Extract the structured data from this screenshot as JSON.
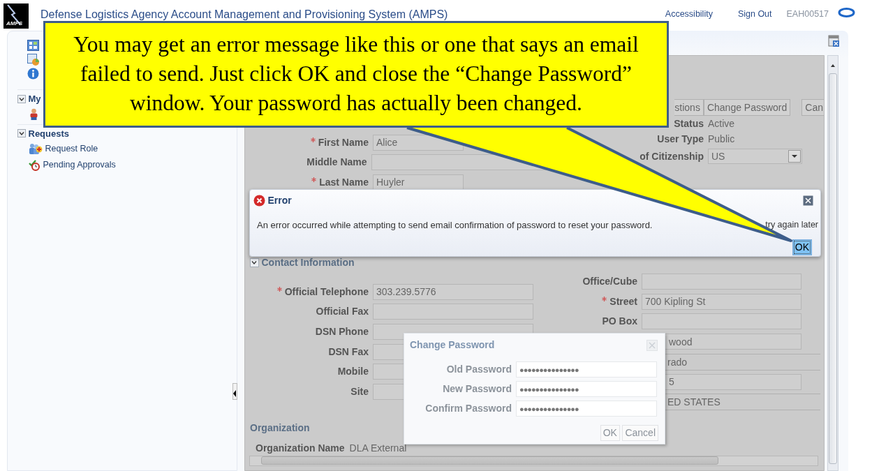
{
  "header": {
    "logo_text": "AMPS",
    "title": "Defense Logistics Agency Account Management and Provisioning System (AMPS)",
    "links": [
      "Accessibility",
      "Sign Out"
    ],
    "user": "EAH00517"
  },
  "sidebar": {
    "sections": [
      {
        "title": "My",
        "expanded": true,
        "items": [
          {
            "kind": "icon"
          }
        ]
      },
      {
        "title": "Requests",
        "expanded": true,
        "items": [
          {
            "kind": "link",
            "label": "Request Role"
          },
          {
            "kind": "link",
            "label": "Pending Approvals"
          }
        ]
      }
    ]
  },
  "personal": {
    "toolbar": [
      {
        "label": "stions"
      },
      {
        "label": "Change Password"
      },
      {
        "label": "Can"
      }
    ],
    "left": [
      {
        "label": "First Name",
        "required": true,
        "kind": "input",
        "value": "Alice"
      },
      {
        "label": "Middle Name",
        "required": false,
        "kind": "input"
      },
      {
        "label": "Last Name",
        "required": true,
        "kind": "input",
        "value": "Huyler"
      }
    ],
    "right": [
      {
        "label": "Status",
        "required": false,
        "kind": "text",
        "value": "Active"
      },
      {
        "label": "User Type",
        "required": false,
        "kind": "text",
        "value": "Public"
      },
      {
        "label": "of Citizenship",
        "required": false,
        "kind": "select",
        "value": "US"
      }
    ]
  },
  "error_dialog": {
    "title": "Error",
    "message": "An error occurred while attempting to send email confirmation of password to reset your password.",
    "message_end": "try again later",
    "button": {
      "label": "OK",
      "focused": true
    }
  },
  "contact": {
    "title": "Contact Information",
    "expanded": true,
    "left": [
      {
        "label": "Official Telephone",
        "required": true,
        "kind": "input",
        "value": "303.239.5776"
      },
      {
        "label": "Official Fax",
        "required": false,
        "kind": "input"
      },
      {
        "label": "DSN Phone",
        "required": false,
        "kind": "input"
      },
      {
        "label": "DSN Fax",
        "required": false,
        "kind": "input"
      },
      {
        "label": "Mobile",
        "required": false,
        "kind": "input"
      },
      {
        "label": "Site",
        "required": false,
        "kind": "input"
      }
    ],
    "right": [
      {
        "label": "Office/Cube",
        "required": false,
        "kind": "input"
      },
      {
        "label": "Street",
        "required": true,
        "kind": "input",
        "value": "700 Kipling St"
      },
      {
        "label": "PO Box",
        "required": false,
        "kind": "input"
      },
      {
        "kind": "input",
        "value": "wood"
      },
      {
        "kind": "text",
        "value": "rado"
      },
      {
        "kind": "input",
        "value": "5"
      },
      {
        "kind": "text",
        "value": "ED STATES"
      }
    ]
  },
  "organization": {
    "title": "Organization",
    "fields": [
      {
        "label": "Organization Name",
        "value": "DLA External"
      }
    ]
  },
  "change_password": {
    "title": "Change Password",
    "active": false,
    "fields": [
      {
        "label": "Old Password",
        "value": "●●●●●●●●●●●●●●●"
      },
      {
        "label": "New Password",
        "value": "●●●●●●●●●●●●●●●"
      },
      {
        "label": "Confirm Password",
        "value": "●●●●●●●●●●●●●●●"
      }
    ],
    "buttons": [
      "OK",
      "Cancel"
    ]
  },
  "callout": {
    "text": "You may get an error message like this or one that says an email failed to send. Just click OK and close the “Change Password” window. Your password has actually been changed."
  }
}
